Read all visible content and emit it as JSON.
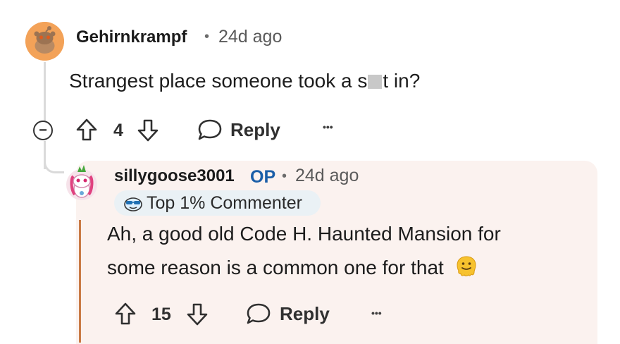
{
  "comment": {
    "username": "Gehirnkrampf",
    "separator": "•",
    "time": "24d ago",
    "body_before": "Strangest place someone took a s",
    "body_after": "t in?",
    "votes": "4",
    "reply_label": "Reply",
    "more_label": "•••",
    "collapse_label": "−"
  },
  "reply": {
    "username": "sillygoose3001",
    "op_label": "OP",
    "separator": "•",
    "time": "24d ago",
    "badge": "Top 1% Commenter",
    "line1": "Ah, a good old Code H. Haunted Mansion for",
    "line2": "some reason is a common one for that",
    "votes": "15",
    "reply_label": "Reply",
    "more_label": "•••"
  },
  "colors": {
    "accent_op": "#1a5ea8",
    "reply_background": "#fbf2ef",
    "avatar_orange": "#f3a258"
  }
}
